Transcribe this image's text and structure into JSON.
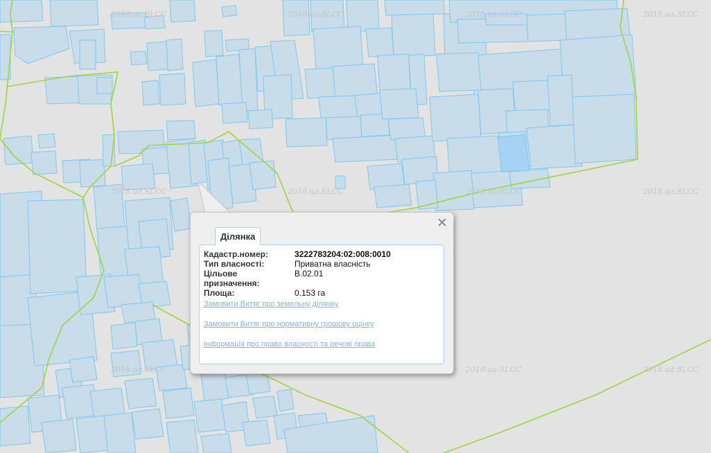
{
  "map": {
    "watermark_text": "2018.ua.SLCC",
    "colors": {
      "background": "#e3e3e3",
      "parcel_fill": "#c8dcea",
      "parcel_stroke": "#7ec8f0",
      "selected_parcel_fill": "#a6d2f3",
      "boundary_line": "#9fd63a"
    }
  },
  "popup": {
    "tab_title": "Ділянка",
    "fields": [
      {
        "label": "Кадастр.номер:",
        "value": "3222783204:02:008:0010"
      },
      {
        "label": "Тип власності:",
        "value": "Приватна власність"
      },
      {
        "label": "Цільове призначення:",
        "value": "В.02.01"
      },
      {
        "label": "Площа:",
        "value": "0.153 га"
      }
    ],
    "links": [
      "Замовити Витяг про земельну ділянку",
      "Замовити Витяг про нормативну грошову оцінку",
      "Інформація про право власності та речові права"
    ],
    "close_icon": "close-icon"
  }
}
